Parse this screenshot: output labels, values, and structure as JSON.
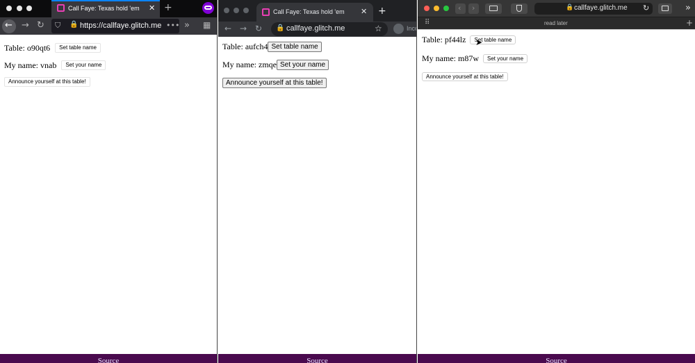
{
  "firefox": {
    "tab_title": "Call Faye: Texas hold 'em",
    "url": "https://callfaye.glitch.me",
    "page": {
      "table_label": "Table: o90qt6",
      "set_table_button": "Set table name",
      "name_label": "My name: vnab",
      "set_name_button": "Set your name",
      "announce_button": "Announce yourself at this table!",
      "footer_link": "Source"
    }
  },
  "chrome": {
    "tab_title": "Call Faye: Texas hold 'em",
    "url": "callfaye.glitch.me",
    "incognito_label": "Inco",
    "page": {
      "table_label": "Table: aufch4",
      "set_table_button": "Set table name",
      "name_label": "My name: zmqe",
      "set_name_button": "Set your name",
      "announce_button": "Announce yourself at this table!",
      "footer_link": "Source"
    }
  },
  "safari": {
    "url": "callfaye.glitch.me",
    "reading_list_label": "read later",
    "page": {
      "table_label": "Table: pf44lz",
      "set_table_button": "Set table name",
      "name_label": "My name: m87w",
      "set_name_button": "Set your name",
      "announce_button": "Announce yourself at this table!",
      "footer_link": "Source"
    }
  },
  "colors": {
    "footer_bg": "#4a0a4e",
    "firefox_accent": "#0a84ff",
    "private_badge": "#8000d7"
  }
}
